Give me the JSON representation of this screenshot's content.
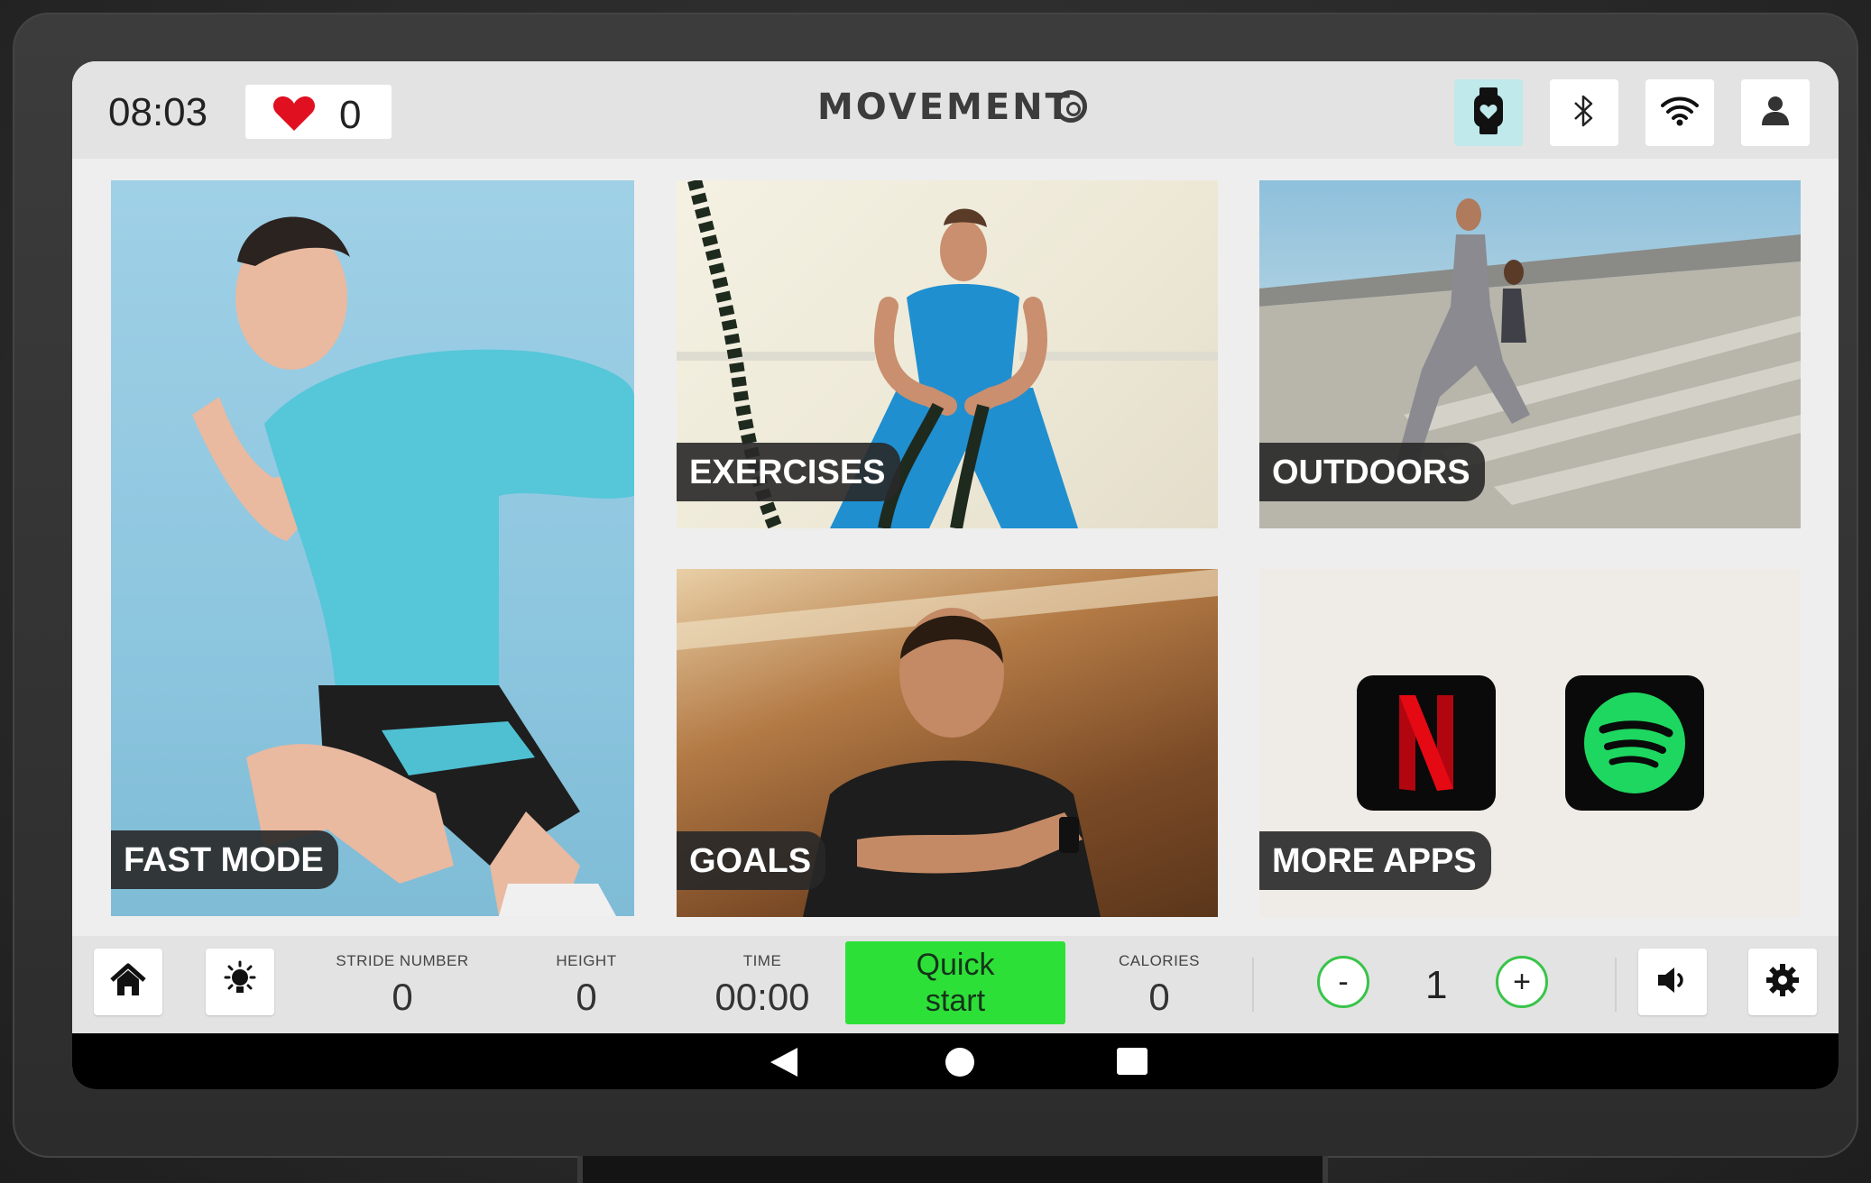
{
  "topbar": {
    "time": "08:03",
    "heart_rate": "0",
    "brand": "MOVEMENT",
    "icons": [
      "watch-icon",
      "bluetooth-icon",
      "wifi-icon",
      "user-icon"
    ]
  },
  "tiles": {
    "fast_mode": "FAST MODE",
    "exercises": "EXERCISES",
    "outdoors": "OUTDOORS",
    "goals": "GOALS",
    "more_apps": "MORE APPS",
    "apps": [
      "Netflix",
      "Spotify"
    ]
  },
  "bottombar": {
    "stride_label": "STRIDE NUMBER",
    "stride_value": "0",
    "height_label": "HEIGHT",
    "height_value": "0",
    "time_label": "TIME",
    "time_value": "00:00",
    "quick_start_line1": "Quick",
    "quick_start_line2": "start",
    "calories_label": "CALORIES",
    "calories_value": "0",
    "minus": "-",
    "level": "1",
    "plus": "+"
  },
  "colors": {
    "accent_green": "#2de038",
    "stepper_green": "#39c44a",
    "heart_red": "#e01020",
    "watch_active_bg": "#bfe9ea",
    "netflix_red": "#e50914",
    "spotify_green": "#1ed760"
  }
}
